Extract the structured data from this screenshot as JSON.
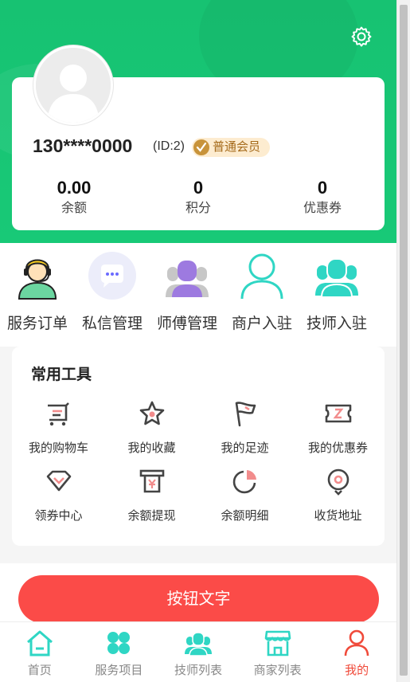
{
  "profile": {
    "phone": "130****0000",
    "user_id": "(ID:2)",
    "member_level": "普通会员"
  },
  "stats": [
    {
      "value": "0.00",
      "label": "余额"
    },
    {
      "value": "0",
      "label": "积分"
    },
    {
      "value": "0",
      "label": "优惠券"
    }
  ],
  "quick_menu": [
    {
      "label": "服务订单",
      "icon": "customer-service-icon"
    },
    {
      "label": "私信管理",
      "icon": "chat-bubble-icon"
    },
    {
      "label": "师傅管理",
      "icon": "worker-group-icon"
    },
    {
      "label": "商户入驻",
      "icon": "person-outline-icon"
    },
    {
      "label": "技师入驻",
      "icon": "team-icon"
    }
  ],
  "tools": {
    "title": "常用工具",
    "items": [
      {
        "label": "我的购物车",
        "icon": "cart-icon"
      },
      {
        "label": "我的收藏",
        "icon": "star-icon"
      },
      {
        "label": "我的足迹",
        "icon": "flag-icon"
      },
      {
        "label": "我的优惠券",
        "icon": "ticket-icon"
      },
      {
        "label": "领券中心",
        "icon": "diamond-icon"
      },
      {
        "label": "余额提现",
        "icon": "withdraw-icon"
      },
      {
        "label": "余额明细",
        "icon": "pie-chart-icon"
      },
      {
        "label": "收货地址",
        "icon": "location-icon"
      }
    ]
  },
  "action_button": "按钮文字",
  "tabbar": [
    {
      "label": "首页",
      "icon": "home-icon"
    },
    {
      "label": "服务项目",
      "icon": "clover-icon"
    },
    {
      "label": "技师列表",
      "icon": "technicians-icon"
    },
    {
      "label": "商家列表",
      "icon": "shop-icon"
    },
    {
      "label": "我的",
      "icon": "user-icon",
      "active": true
    }
  ],
  "colors": {
    "primary_green": "#17c272",
    "accent_red": "#fb4b48",
    "tool_icon_dark": "#444444",
    "tool_icon_accent": "#f28c8c",
    "tab_teal": "#2fd6c4"
  }
}
